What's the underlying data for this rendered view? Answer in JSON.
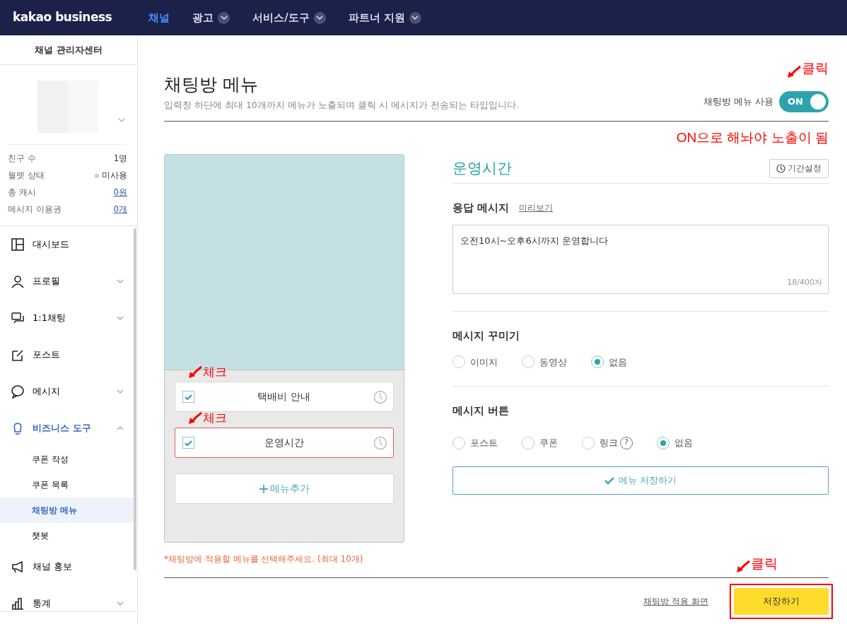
{
  "topnav": {
    "logo": "kakao business",
    "items": [
      {
        "label": "채널",
        "selected": true,
        "dropdown": false
      },
      {
        "label": "광고",
        "selected": false,
        "dropdown": true
      },
      {
        "label": "서비스/도구",
        "selected": false,
        "dropdown": true
      },
      {
        "label": "파트너 지원",
        "selected": false,
        "dropdown": true
      }
    ]
  },
  "sidebar": {
    "title": "채널 관리자센터",
    "stats": [
      {
        "label": "친구 수",
        "value": "1명",
        "kind": "plain"
      },
      {
        "label": "월렛 상태",
        "value": "미사용",
        "kind": "status"
      },
      {
        "label": "총 캐시",
        "value": "0원",
        "kind": "link"
      },
      {
        "label": "메시지 이용권",
        "value": "0개",
        "kind": "link"
      }
    ],
    "menu": [
      {
        "label": "대시보드",
        "selected": false
      },
      {
        "label": "프로필",
        "selected": false,
        "expanded": false
      },
      {
        "label": "1:1채팅",
        "selected": false,
        "expanded": false
      },
      {
        "label": "포스트",
        "selected": false
      },
      {
        "label": "메시지",
        "selected": false,
        "expanded": false
      },
      {
        "label": "비즈니스 도구",
        "selected": true,
        "expanded": true,
        "children": [
          {
            "label": "쿠폰 작성",
            "selected": false
          },
          {
            "label": "쿠폰 목록",
            "selected": false
          },
          {
            "label": "채팅방 메뉴",
            "selected": true
          },
          {
            "label": "챗봇",
            "selected": false
          }
        ]
      },
      {
        "label": "채널 홍보",
        "selected": false
      },
      {
        "label": "통계",
        "selected": false,
        "expanded": false
      }
    ]
  },
  "page": {
    "title": "채팅방 메뉴",
    "description": "입력창 하단에 최대 10개까지 메뉴가 노출되며 클릭 시 메시지가 전송되는 타입입니다.",
    "toggle": {
      "label": "채팅방 메뉴 사용",
      "on": true,
      "text": "ON",
      "annotation": "클릭",
      "note": "ON으로 해놔야 노출이 됨"
    }
  },
  "preview": {
    "menu_items": [
      {
        "label": "택배비 안내",
        "checked": true,
        "selected": false,
        "annotation": "체크"
      },
      {
        "label": "운영시간",
        "checked": true,
        "selected": true,
        "annotation": "체크"
      }
    ],
    "add_button": "메뉴추가",
    "note": "*채팅방에 적용할 메뉴를 선택해주세요. (최대 10개)"
  },
  "editor": {
    "title": "운영시간",
    "period_button": "기간설정",
    "response": {
      "label": "응답 메시지",
      "preview_link": "미리보기",
      "value": "오전10시~오후6시까지 운영합니다",
      "counter": "18/400자"
    },
    "decorate": {
      "label": "메시지 꾸미기",
      "options": [
        {
          "label": "이미지",
          "selected": false
        },
        {
          "label": "동영상",
          "selected": false
        },
        {
          "label": "없음",
          "selected": true
        }
      ]
    },
    "buttons": {
      "label": "메시지 버튼",
      "options": [
        {
          "label": "포스트",
          "selected": false
        },
        {
          "label": "쿠폰",
          "selected": false
        },
        {
          "label": "링크",
          "selected": false,
          "help": "?"
        },
        {
          "label": "없음",
          "selected": true
        }
      ]
    },
    "save_menu_button": "메뉴 저장하기"
  },
  "footer": {
    "preview_link": "채팅방 적용 화면",
    "save_button": "저장하기",
    "highlighted": true,
    "annotation": "클릭"
  }
}
